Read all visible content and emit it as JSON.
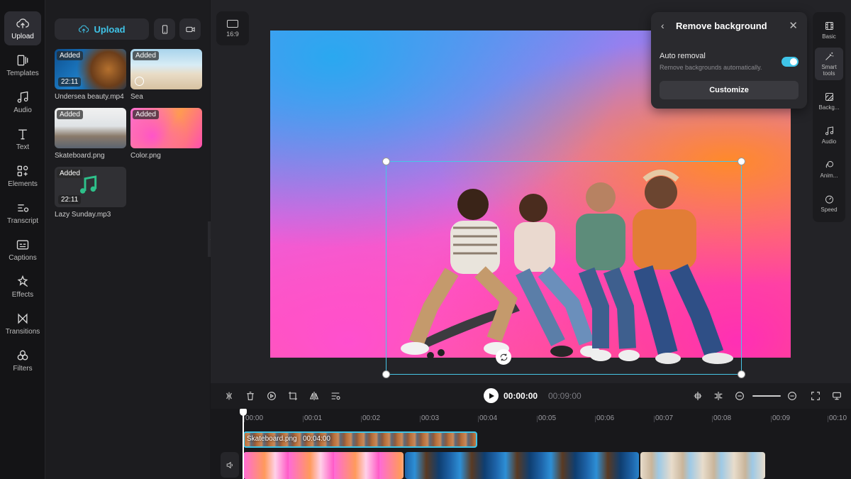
{
  "rail": {
    "items": [
      {
        "label": "Upload",
        "icon": "cloud-upload-icon"
      },
      {
        "label": "Templates",
        "icon": "templates-icon"
      },
      {
        "label": "Audio",
        "icon": "music-note-icon"
      },
      {
        "label": "Text",
        "icon": "text-icon"
      },
      {
        "label": "Elements",
        "icon": "elements-icon"
      },
      {
        "label": "Transcript",
        "icon": "transcript-icon"
      },
      {
        "label": "Captions",
        "icon": "captions-icon"
      },
      {
        "label": "Effects",
        "icon": "effects-icon"
      },
      {
        "label": "Transitions",
        "icon": "transitions-icon"
      },
      {
        "label": "Filters",
        "icon": "filters-icon"
      }
    ]
  },
  "media": {
    "upload_label": "Upload",
    "assets": [
      {
        "name": "Undersea beauty.mp4",
        "badge": "Added",
        "duration": "22:11"
      },
      {
        "name": "Sea",
        "badge": "Added",
        "duration": ""
      },
      {
        "name": "Skateboard.png",
        "badge": "Added",
        "duration": ""
      },
      {
        "name": "Color.png",
        "badge": "Added",
        "duration": ""
      },
      {
        "name": "Lazy Sunday.mp3",
        "badge": "Added",
        "duration": "22:11"
      }
    ]
  },
  "canvas": {
    "ratio_label": "16:9"
  },
  "popup": {
    "title": "Remove background",
    "auto_label": "Auto removal",
    "auto_desc": "Remove backgrounds automatically.",
    "customize_label": "Customize",
    "auto_enabled": true
  },
  "right_panel": {
    "items": [
      {
        "label": "Basic",
        "icon": "film-icon"
      },
      {
        "label": "Smart tools",
        "icon": "magic-wand-icon"
      },
      {
        "label": "Backg...",
        "icon": "background-icon"
      },
      {
        "label": "Audio",
        "icon": "music-note-icon"
      },
      {
        "label": "Anim...",
        "icon": "animation-icon"
      },
      {
        "label": "Speed",
        "icon": "speed-icon"
      }
    ]
  },
  "toolbar": {
    "current_time": "00:00:00",
    "total_time": "00:09:00"
  },
  "timeline": {
    "ticks": [
      "00:00",
      "00:01",
      "00:02",
      "00:03",
      "00:04",
      "00:05",
      "00:06",
      "00:07",
      "00:08",
      "00:09",
      "00:10"
    ],
    "overlay_clip": {
      "label": "Skateboard.png",
      "duration": "00:04:00"
    }
  },
  "colors": {
    "accent": "#3fc4e8",
    "panel": "#1c1c1f",
    "canvas_bg": "#232327"
  }
}
